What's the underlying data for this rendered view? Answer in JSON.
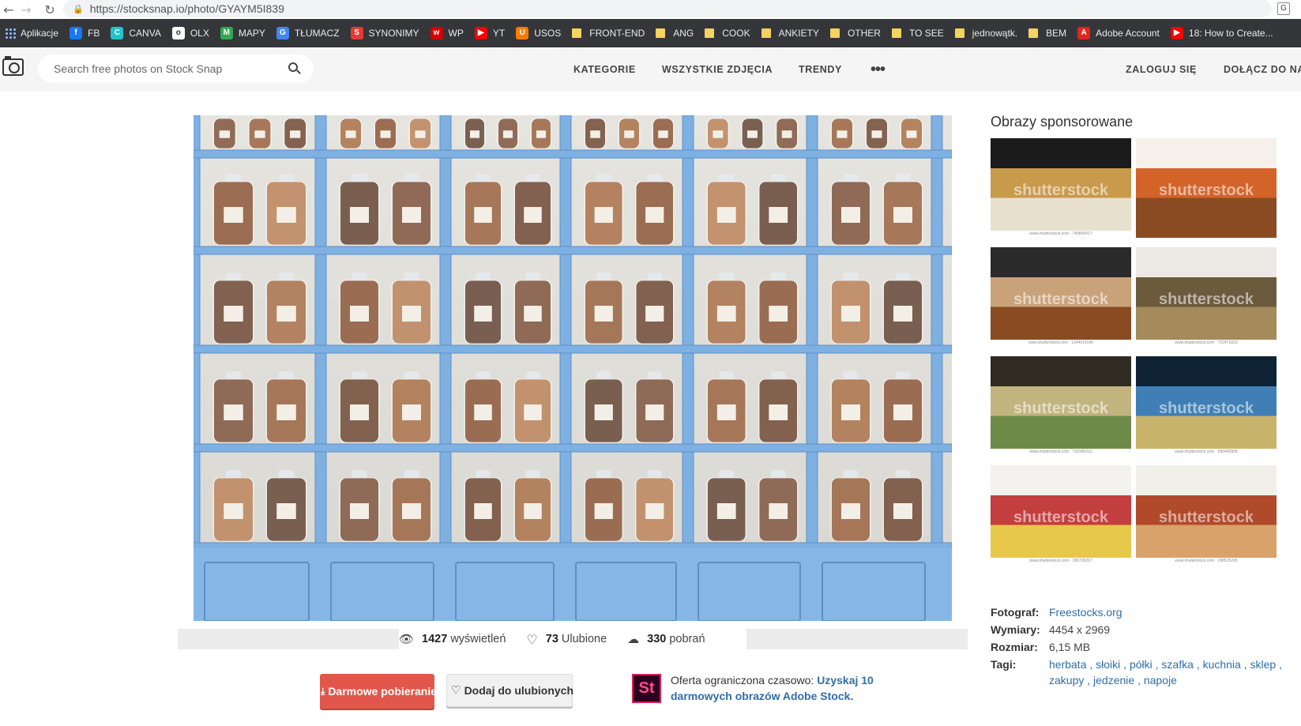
{
  "browser": {
    "url": "https://stocksnap.io/photo/GYAYM5I839",
    "bookmarks": [
      {
        "label": "Aplikacje",
        "icon": "apps-icon",
        "color": "#8ab4f8",
        "glyph": ""
      },
      {
        "label": "FB",
        "icon": "facebook-icon",
        "color": "#1877f2",
        "glyph": "f"
      },
      {
        "label": "CANVA",
        "icon": "canva-icon",
        "color": "#20c4cb",
        "glyph": "C"
      },
      {
        "label": "OLX",
        "icon": "olx-icon",
        "color": "#ffffff",
        "glyph": "o"
      },
      {
        "label": "MAPY",
        "icon": "maps-icon",
        "color": "#34a853",
        "glyph": "M"
      },
      {
        "label": "TŁUMACZ",
        "icon": "translate-icon",
        "color": "#4285f4",
        "glyph": "G"
      },
      {
        "label": "SYNONIMY",
        "icon": "synonyms-icon",
        "color": "#e53935",
        "glyph": "S"
      },
      {
        "label": "WP",
        "icon": "wp-icon",
        "color": "#d50000",
        "glyph": "w"
      },
      {
        "label": "YT",
        "icon": "youtube-icon",
        "color": "#ff0000",
        "glyph": "▶"
      },
      {
        "label": "USOS",
        "icon": "usos-icon",
        "color": "#f57c00",
        "glyph": "U"
      },
      {
        "label": "FRONT-END",
        "icon": "folder-icon",
        "color": "#f4d35e",
        "glyph": ""
      },
      {
        "label": "ANG",
        "icon": "folder-icon",
        "color": "#f4d35e",
        "glyph": ""
      },
      {
        "label": "COOK",
        "icon": "folder-icon",
        "color": "#f4d35e",
        "glyph": ""
      },
      {
        "label": "ANKIETY",
        "icon": "folder-icon",
        "color": "#f4d35e",
        "glyph": ""
      },
      {
        "label": "OTHER",
        "icon": "folder-icon",
        "color": "#f4d35e",
        "glyph": ""
      },
      {
        "label": "TO SEE",
        "icon": "folder-icon",
        "color": "#f4d35e",
        "glyph": ""
      },
      {
        "label": "jednowątk.",
        "icon": "folder-icon",
        "color": "#f4d35e",
        "glyph": ""
      },
      {
        "label": "BEM",
        "icon": "folder-icon",
        "color": "#f4d35e",
        "glyph": ""
      },
      {
        "label": "Adobe Account",
        "icon": "adobe-icon",
        "color": "#e1251b",
        "glyph": "A"
      },
      {
        "label": "18: How to Create...",
        "icon": "youtube-icon",
        "color": "#ff0000",
        "glyph": "▶"
      }
    ]
  },
  "header": {
    "search_placeholder": "Search free photos on Stock Snap",
    "nav": [
      "KATEGORIE",
      "WSZYSTKIE ZDJĘCIA",
      "TRENDY"
    ],
    "more": "•••",
    "login": "ZALOGUJ SIĘ",
    "join": "DOŁĄCZ DO NAS"
  },
  "stats": {
    "views_count": "1427",
    "views_label": "wyświetleń",
    "likes_count": "73",
    "likes_label": "Ulubione",
    "downloads_count": "330",
    "downloads_label": "pobrań"
  },
  "actions": {
    "download": "Darmowe pobieranie",
    "favorite": "Dodaj do ulubionych"
  },
  "offer": {
    "logo": "St",
    "text": "Oferta ograniczona czasowo:",
    "link": "Uzyskaj 10 darmowych obrazów Adobe Stock."
  },
  "sidebar": {
    "title": "Obrazy sponsorowane",
    "watermark": "shutterstock",
    "thumbs": [
      {
        "foot": "www.shutterstock.com · 740805417"
      },
      {
        "foot": ""
      },
      {
        "foot": "www.shutterstock.com · 1244314145"
      },
      {
        "foot": "www.shutterstock.com · 722471833"
      },
      {
        "foot": "www.shutterstock.com · 718180310"
      },
      {
        "foot": "www.shutterstock.com · 596482808"
      },
      {
        "foot": "www.shutterstock.com · 296705267"
      },
      {
        "foot": "www.shutterstock.com · 298525295"
      }
    ]
  },
  "info": {
    "photographer_key": "Fotograf:",
    "photographer": "Freestocks.org",
    "dimensions_key": "Wymiary:",
    "dimensions": "4454 x 2969",
    "size_key": "Rozmiar:",
    "size": "6,15 MB",
    "tags_key": "Tagi:",
    "tags": [
      "herbata",
      "słoiki",
      "półki",
      "szafka",
      "kuchnia",
      "sklep",
      "zakupy",
      "jedzenie",
      "napoje"
    ]
  },
  "colors": {
    "accent": "#e2574c",
    "link": "#2f6ea8",
    "bookmarks_bg": "#35363a",
    "shelf_blue": "#7aaee0"
  }
}
